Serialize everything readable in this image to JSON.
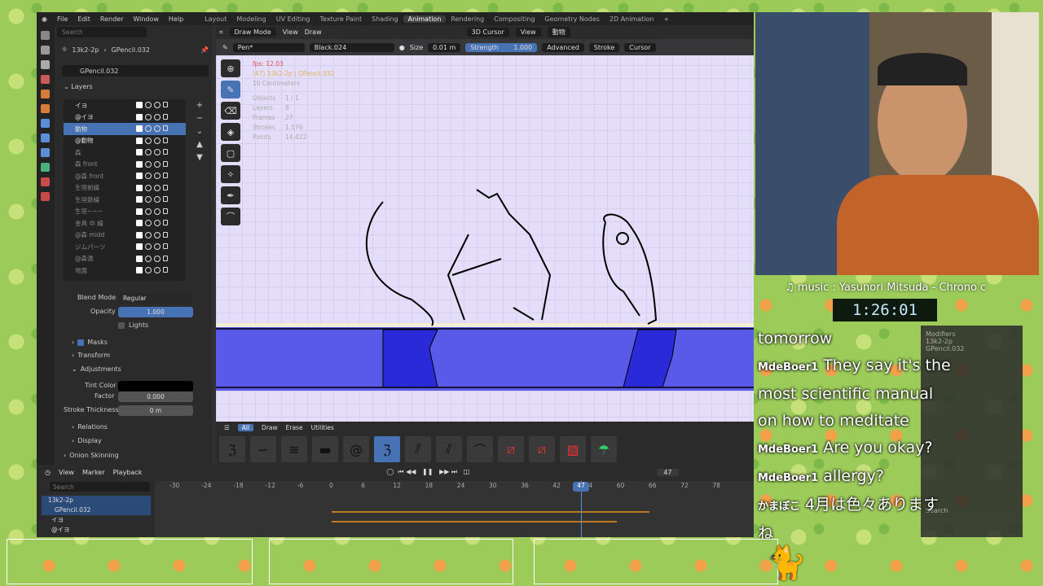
{
  "menu": {
    "items": [
      "File",
      "Edit",
      "Render",
      "Window",
      "Help"
    ],
    "workspaces": [
      "Layout",
      "Modeling",
      "UV Editing",
      "Texture Paint",
      "Shading",
      "Animation",
      "Rendering",
      "Compositing",
      "Geometry Nodes",
      "2D Animation",
      "+"
    ],
    "active_workspace": "Animation"
  },
  "props": {
    "search_placeholder": "Search",
    "breadcrumb_scene": "13k2-2p",
    "breadcrumb_obj": "GPencil.032",
    "data_name": "GPencil.032",
    "layers_title": "Layers",
    "layers": [
      "イヨ",
      "@イヨ",
      "動物",
      "@動物",
      "森",
      "森 front",
      "@森 front",
      "生垣前線",
      "生垣鉄線",
      "生垣~~~",
      "金具 中 線",
      "@森 midd",
      "ジムパーツ",
      "@森温",
      "地面"
    ],
    "blend_mode_label": "Blend Mode",
    "blend_mode": "Regular",
    "opacity_label": "Opacity",
    "opacity": "1.000",
    "lights": "Lights",
    "masks": "Masks",
    "transform": "Transform",
    "adjustments": "Adjustments",
    "tint_color": "Tint Color",
    "factor_label": "Factor",
    "factor": "0.000",
    "stroke_thickness_label": "Stroke Thickness",
    "stroke_thickness": "0 m",
    "relations": "Relations",
    "display": "Display",
    "onion": "Onion Skinning"
  },
  "viewport": {
    "mode": "Draw Mode",
    "view": "View",
    "draw": "Draw",
    "cursor3d": "3D Cursor",
    "view2": "View",
    "collection": "動物",
    "brush": "Pen*",
    "material": "Black.024",
    "size_label": "Size",
    "size": "0.01 m",
    "strength_label": "Strength",
    "strength": "1.000",
    "advanced": "Advanced",
    "stroke": "Stroke",
    "cursor": "Cursor",
    "fps": "fps: 12.03",
    "objname": "(47) 13k2-2p | GPencil.032",
    "scale": "10 Centimeters",
    "stats": [
      [
        "Objects",
        "1 / 1"
      ],
      [
        "Layers",
        "8"
      ],
      [
        "Frames",
        "27"
      ],
      [
        "Strokes",
        "1,576"
      ],
      [
        "Points",
        "14,422"
      ]
    ]
  },
  "brushes": {
    "tabs": [
      "All",
      "Draw",
      "Erase",
      "Utilities"
    ]
  },
  "timeline": {
    "view": "View",
    "marker": "Marker",
    "playback": "Playback",
    "search_placeholder": "Search",
    "current_frame": "47",
    "frame_display": "47",
    "ticks": [
      "-30",
      "-24",
      "-18",
      "-12",
      "-6",
      "0",
      "6",
      "12",
      "18",
      "24",
      "30",
      "36",
      "42",
      "54",
      "60",
      "66",
      "72",
      "78"
    ],
    "channels": [
      "13k2-2p",
      "GPencil.032",
      "イヨ",
      "@イヨ"
    ]
  },
  "stream": {
    "music": "♫ music : Yasunori Mitsuda - Chrono c",
    "timer": "1:26:01",
    "chat": [
      {
        "user": "",
        "text": "tomorrow"
      },
      {
        "user": "MdeBoer1",
        "text": "They say it's the"
      },
      {
        "user": "",
        "text": "most scientific manual"
      },
      {
        "user": "",
        "text": "on how to meditate"
      },
      {
        "user": "MdeBoer1",
        "text": "Are you okay?"
      },
      {
        "user": "MdeBoer1",
        "text": "allergy?"
      },
      {
        "user": "かまぼこ",
        "text": "4月は色々あります"
      },
      {
        "user": "",
        "text": "ね"
      }
    ],
    "side_items": [
      "Modifiers",
      "13k2-2p",
      "GPencil.032",
      "Search"
    ]
  }
}
